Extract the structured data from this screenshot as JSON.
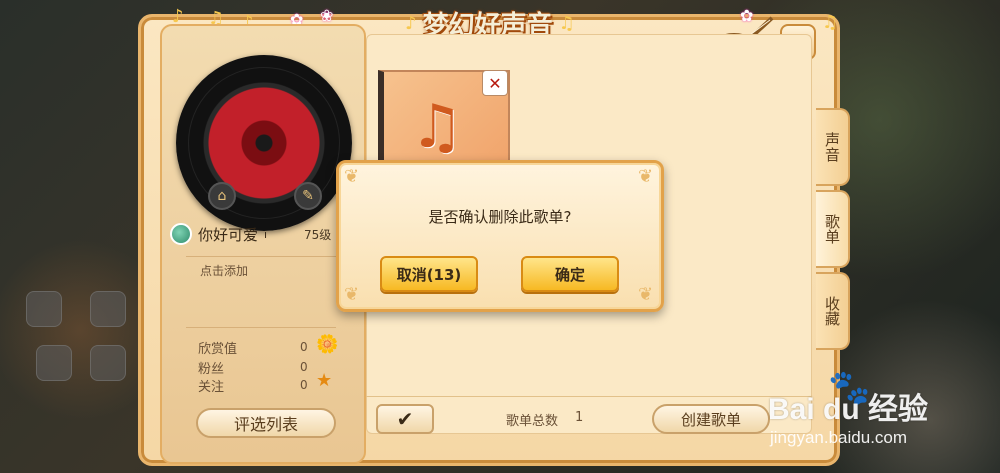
{
  "window": {
    "title": "梦幻好声音",
    "close_icon": "close-icon"
  },
  "profile": {
    "username": "你好可爱",
    "username_suffix": "ı",
    "level": "75级",
    "bio_placeholder": "点击添加",
    "stats": [
      {
        "label": "欣赏值",
        "value": "0",
        "icon": "flower-icon"
      },
      {
        "label": "粉丝",
        "value": "0",
        "icon": ""
      },
      {
        "label": "关注",
        "value": "0",
        "icon": "star-icon"
      }
    ],
    "pick_list_label": "评选列表"
  },
  "songlist": {
    "total_label": "歌单总数",
    "total_value": "1",
    "create_label": "创建歌单"
  },
  "side_tabs": [
    {
      "label": "声音",
      "active": false
    },
    {
      "label": "歌单",
      "active": true
    },
    {
      "label": "收藏",
      "active": false
    }
  ],
  "modal": {
    "message": "是否确认删除此歌单?",
    "cancel_label": "取消(13)",
    "confirm_label": "确定"
  },
  "watermark": {
    "logo": "Bai  du 经验",
    "url": "jingyan.baidu.com"
  }
}
